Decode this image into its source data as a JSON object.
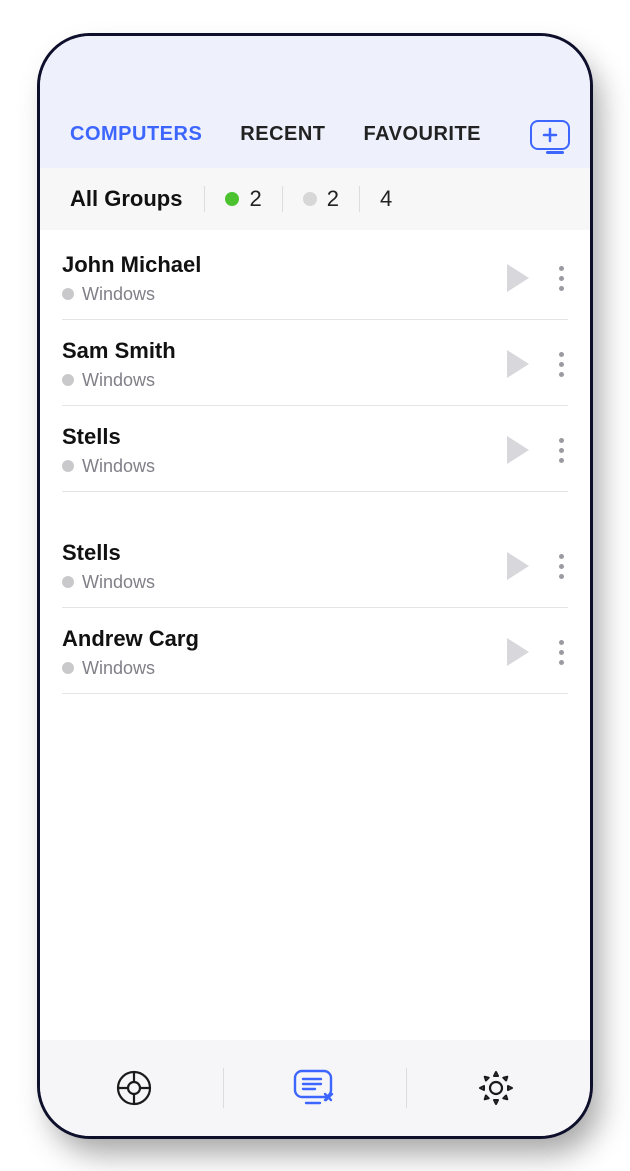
{
  "tabs": {
    "computers": "COMPUTERS",
    "recent": "RECENT",
    "favourite": "FAVOURITE"
  },
  "groups": {
    "title": "All Groups",
    "online": "2",
    "offline": "2",
    "total": "4"
  },
  "computers_list": [
    {
      "name": "John Michael",
      "os": "Windows"
    },
    {
      "name": "Sam Smith",
      "os": "Windows"
    },
    {
      "name": "Stells",
      "os": "Windows"
    },
    {
      "name": "Stells",
      "os": "Windows"
    },
    {
      "name": "Andrew Carg",
      "os": "Windows"
    }
  ]
}
